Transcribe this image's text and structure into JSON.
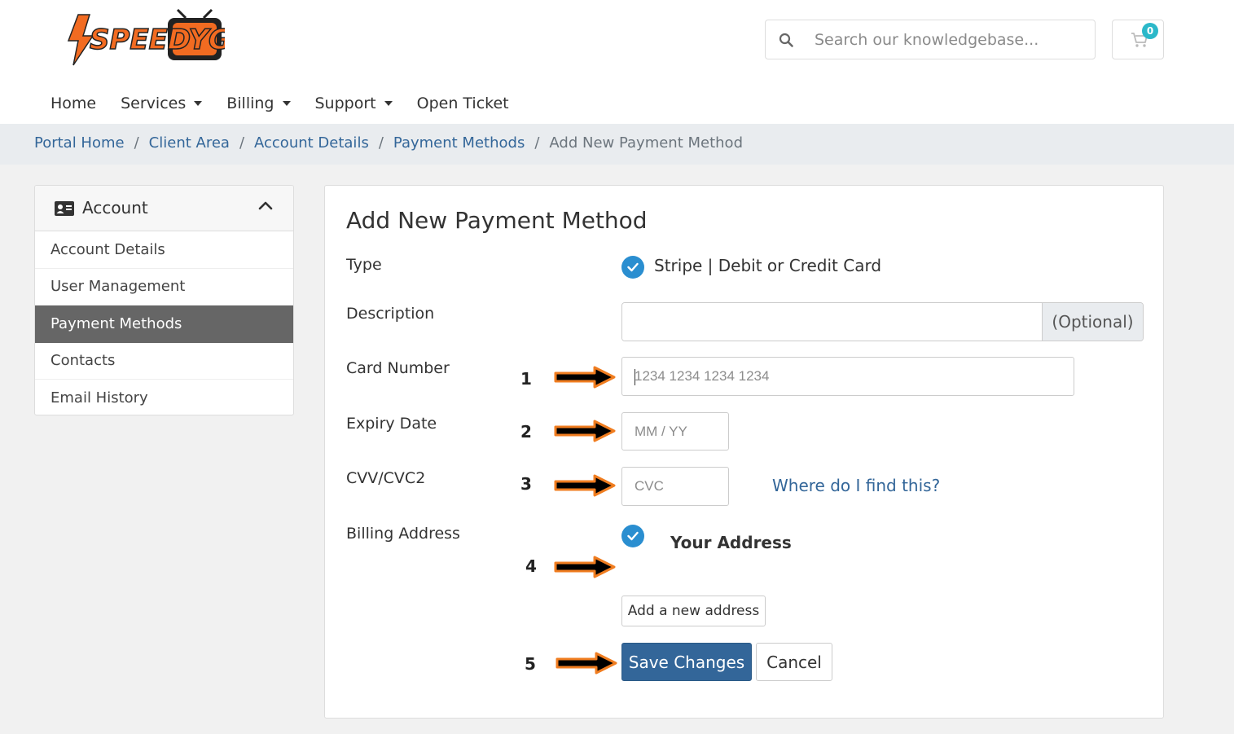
{
  "header": {
    "logo_text": "SPEEDYGO",
    "search": {
      "placeholder": "Search our knowledgebase..."
    },
    "cart": {
      "count": "0"
    }
  },
  "nav": {
    "items": [
      {
        "label": "Home"
      },
      {
        "label": "Services"
      },
      {
        "label": "Billing"
      },
      {
        "label": "Support"
      },
      {
        "label": "Open Ticket"
      }
    ]
  },
  "breadcrumb": {
    "items": [
      "Portal Home",
      "Client Area",
      "Account Details",
      "Payment Methods"
    ],
    "current": "Add New Payment Method",
    "separator": "/"
  },
  "sidebar": {
    "title": "Account",
    "items": [
      {
        "label": "Account Details"
      },
      {
        "label": "User Management"
      },
      {
        "label": "Payment Methods"
      },
      {
        "label": "Contacts"
      },
      {
        "label": "Email History"
      }
    ]
  },
  "form": {
    "title": "Add New Payment Method",
    "type_label": "Type",
    "type_value": "Stripe | Debit or Credit Card",
    "description_label": "Description",
    "description_addon": "(Optional)",
    "card_number_label": "Card Number",
    "card_number_placeholder": "1234 1234 1234 1234",
    "expiry_label": "Expiry Date",
    "expiry_placeholder": "MM / YY",
    "cvv_label": "CVV/CVC2",
    "cvv_placeholder": "CVC",
    "cvv_help": "Where do I find this?",
    "billing_label": "Billing Address",
    "billing_selected": "Your Address",
    "add_address": "Add a new address",
    "save": "Save Changes",
    "cancel": "Cancel"
  },
  "annotations": {
    "steps": [
      "1",
      "2",
      "3",
      "4",
      "5"
    ]
  },
  "colors": {
    "primary": "#336699",
    "check": "#2a8ed0",
    "arrow_outline": "#f07d20",
    "badge": "#2bb8c9",
    "sidebar_active": "#666666"
  }
}
